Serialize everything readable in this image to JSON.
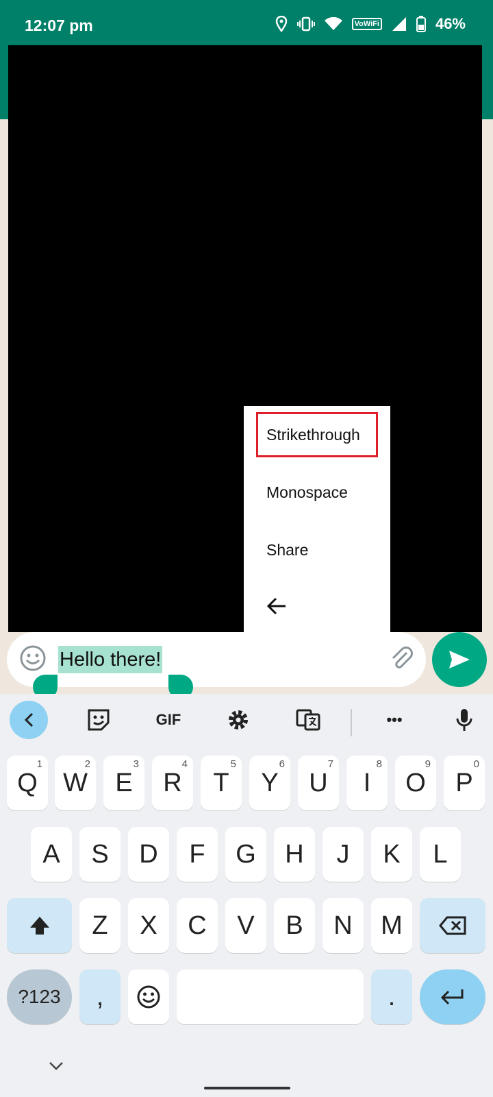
{
  "status_bar": {
    "time": "12:07 pm",
    "battery": "46%",
    "vowifi": "VoWiFi"
  },
  "popup_menu": {
    "items": [
      "Strikethrough",
      "Monospace",
      "Share"
    ]
  },
  "input": {
    "text": "Hello there!"
  },
  "keyboard": {
    "toolbar": {
      "gif": "GIF",
      "more": "•••"
    },
    "row1": [
      {
        "k": "Q",
        "s": "1"
      },
      {
        "k": "W",
        "s": "2"
      },
      {
        "k": "E",
        "s": "3"
      },
      {
        "k": "R",
        "s": "4"
      },
      {
        "k": "T",
        "s": "5"
      },
      {
        "k": "Y",
        "s": "6"
      },
      {
        "k": "U",
        "s": "7"
      },
      {
        "k": "I",
        "s": "8"
      },
      {
        "k": "O",
        "s": "9"
      },
      {
        "k": "P",
        "s": "0"
      }
    ],
    "row2": [
      "A",
      "S",
      "D",
      "F",
      "G",
      "H",
      "J",
      "K",
      "L"
    ],
    "row3": [
      "Z",
      "X",
      "C",
      "V",
      "B",
      "N",
      "M"
    ],
    "symbols": "?123",
    "comma": ",",
    "period": "."
  },
  "colors": {
    "accent": "#008069",
    "send": "#00a884",
    "selection": "#a7e1cf",
    "highlight": "#e01f2a"
  }
}
